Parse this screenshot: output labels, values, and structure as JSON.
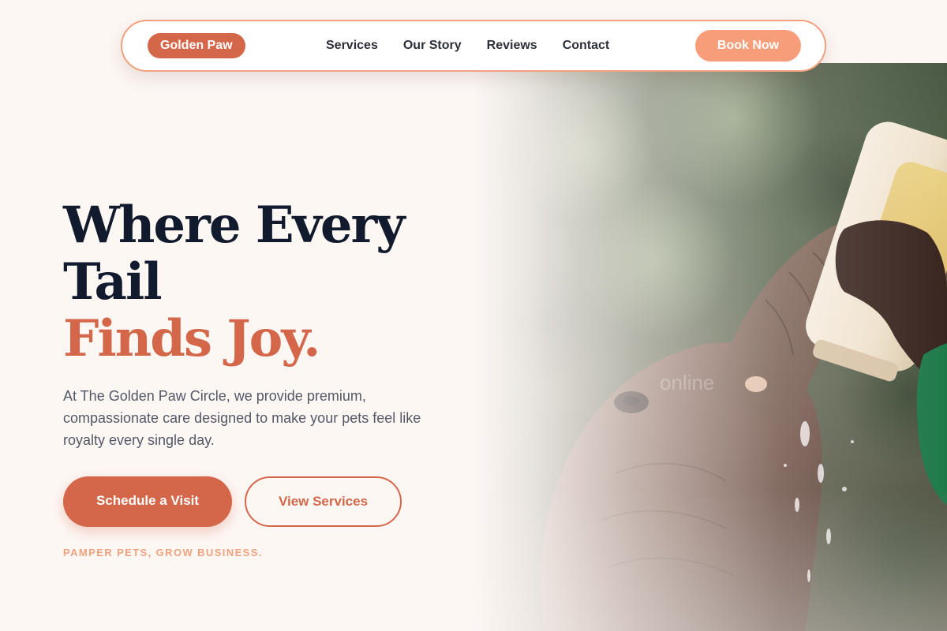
{
  "nav": {
    "brand": "Golden Paw",
    "links": [
      {
        "label": "Services"
      },
      {
        "label": "Our Story"
      },
      {
        "label": "Reviews"
      },
      {
        "label": "Contact"
      }
    ],
    "cta": "Book Now"
  },
  "hero": {
    "headline_line1": "Where Every",
    "headline_line2": "Tail",
    "headline_accent": "Finds Joy.",
    "description": "At The Golden Paw Circle, we provide premium, compassionate care designed to make your pets feel like royalty every single day.",
    "primary_button": "Schedule a Visit",
    "secondary_button": "View Services",
    "tagline": "PAMPER PETS, GROW BUSINESS.",
    "image_subject": "elephant calf drinking from a milk bottle held by a hand",
    "watermark": "online"
  },
  "colors": {
    "background": "#fdf7f4",
    "accent": "#d4674a",
    "accent_light": "#f89d7a",
    "heading": "#121a2e",
    "body_text": "#535866"
  }
}
